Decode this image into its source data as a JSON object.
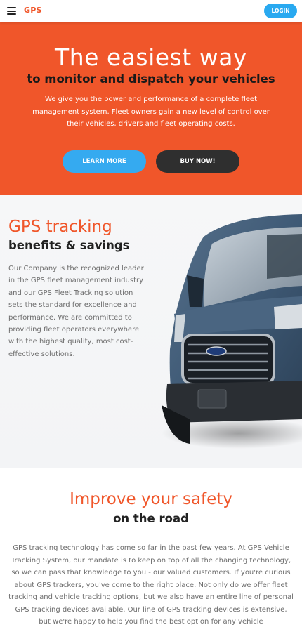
{
  "header": {
    "logo": "GPS",
    "login_label": "LOGIN",
    "menu_icon": "hamburger-icon"
  },
  "hero": {
    "title": "The easiest way",
    "subtitle": "to monitor and dispatch your vehicles",
    "description": "We give you the power and performance of a complete fleet management system. Fleet owners gain a new level of control over their vehicles, drivers and fleet operating costs.",
    "learn_more_label": "LEARN MORE",
    "buy_now_label": "BUY NOW!"
  },
  "tracking": {
    "title": "GPS tracking",
    "subtitle": "benefits & savings",
    "text": "Our Company is the recognized leader in the GPS fleet management industry and our GPS Fleet Tracking solution sets the standard for excellence and performance. We are committed to providing fleet operators everywhere with the highest quality, most cost-effective solutions."
  },
  "safety": {
    "title": "Improve your safety",
    "subtitle": "on the road",
    "text": "GPS tracking technology has come so far in the past few years. At GPS Vehicle Tracking System, our mandate is to keep on top of all the changing technology, so we can pass that knowledge to you - our valued customers. If you're curious about GPS trackers, you've come to the right place. Not only do we offer fleet tracking and vehicle tracking options, but we also have an entire line of personal GPS tracking devices available. Our line of GPS tracking devices is extensive, but we're happy to help you find the best option for any vehicle"
  },
  "colors": {
    "accent": "#f0562a",
    "button_blue": "#35aaf0",
    "button_dark": "#2f2f2f"
  }
}
